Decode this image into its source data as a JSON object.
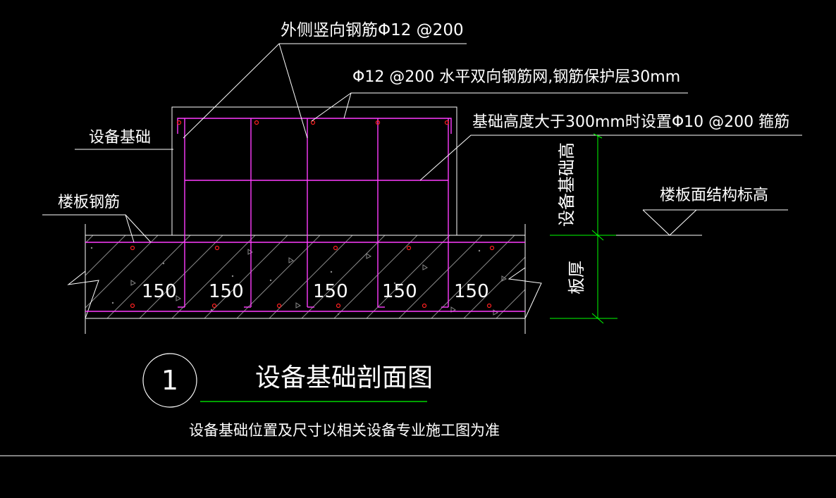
{
  "labels": {
    "outer_vertical_rebar": "外侧竖向钢筋Φ12 @200",
    "horizontal_mesh": "Φ12 @200 水平双向钢筋网,钢筋保护层30mm",
    "stirrup_note": "基础高度大于300mm时设置Φ10 @200 箍筋",
    "equipment_foundation": "设备基础",
    "floor_rebar": "楼板钢筋",
    "floor_structural_elevation": "楼板面结构标高",
    "foundation_height": "设备基础高",
    "slab_thickness": "板厚"
  },
  "dimensions": [
    "150",
    "150",
    "150",
    "150",
    "150"
  ],
  "title": {
    "number": "1",
    "text": "设备基础剖面图",
    "note": "设备基础位置及尺寸以相关设备专业施工图为准"
  },
  "colors": {
    "background": "#000000",
    "lines": "#ffffff",
    "rebar": "#ff3cff",
    "dimension": "#00ff00",
    "rebar_dot": "#ff2020",
    "hatch": "#8a8a8a"
  }
}
